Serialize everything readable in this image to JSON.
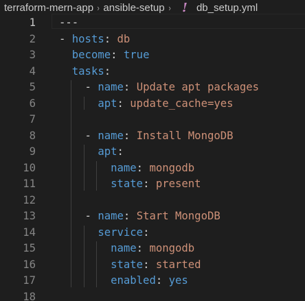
{
  "breadcrumb": {
    "folder1": "terraform-mern-app",
    "folder2": "ansible-setup",
    "file_name": "db_setup.yml",
    "separator": "›",
    "file_icon": "yaml-file-icon"
  },
  "editor": {
    "language": "yaml",
    "active_line": 1,
    "lines": [
      {
        "n": "1",
        "tokens": [
          [
            "t-dash",
            "---"
          ]
        ]
      },
      {
        "n": "2",
        "tokens": [
          [
            "t-dash",
            "- "
          ],
          [
            "t-key",
            "hosts"
          ],
          [
            "t-colon",
            ": "
          ],
          [
            "t-str",
            "db"
          ]
        ]
      },
      {
        "n": "3",
        "tokens": [
          [
            "t-dash",
            "  "
          ],
          [
            "t-key",
            "become"
          ],
          [
            "t-colon",
            ": "
          ],
          [
            "t-bool",
            "true"
          ]
        ]
      },
      {
        "n": "4",
        "tokens": [
          [
            "t-dash",
            "  "
          ],
          [
            "t-key",
            "tasks"
          ],
          [
            "t-colon",
            ":"
          ]
        ]
      },
      {
        "n": "5",
        "tokens": [
          [
            "t-dash",
            "    - "
          ],
          [
            "t-key",
            "name"
          ],
          [
            "t-colon",
            ": "
          ],
          [
            "t-str",
            "Update apt packages"
          ]
        ]
      },
      {
        "n": "6",
        "tokens": [
          [
            "t-dash",
            "      "
          ],
          [
            "t-key",
            "apt"
          ],
          [
            "t-colon",
            ": "
          ],
          [
            "t-str",
            "update_cache=yes"
          ]
        ]
      },
      {
        "n": "7",
        "tokens": []
      },
      {
        "n": "8",
        "tokens": [
          [
            "t-dash",
            "    - "
          ],
          [
            "t-key",
            "name"
          ],
          [
            "t-colon",
            ": "
          ],
          [
            "t-str",
            "Install MongoDB"
          ]
        ]
      },
      {
        "n": "9",
        "tokens": [
          [
            "t-dash",
            "      "
          ],
          [
            "t-key",
            "apt"
          ],
          [
            "t-colon",
            ":"
          ]
        ]
      },
      {
        "n": "10",
        "tokens": [
          [
            "t-dash",
            "        "
          ],
          [
            "t-key",
            "name"
          ],
          [
            "t-colon",
            ": "
          ],
          [
            "t-str",
            "mongodb"
          ]
        ]
      },
      {
        "n": "11",
        "tokens": [
          [
            "t-dash",
            "        "
          ],
          [
            "t-key",
            "state"
          ],
          [
            "t-colon",
            ": "
          ],
          [
            "t-str",
            "present"
          ]
        ]
      },
      {
        "n": "12",
        "tokens": []
      },
      {
        "n": "13",
        "tokens": [
          [
            "t-dash",
            "    - "
          ],
          [
            "t-key",
            "name"
          ],
          [
            "t-colon",
            ": "
          ],
          [
            "t-str",
            "Start MongoDB"
          ]
        ]
      },
      {
        "n": "14",
        "tokens": [
          [
            "t-dash",
            "      "
          ],
          [
            "t-key",
            "service"
          ],
          [
            "t-colon",
            ":"
          ]
        ]
      },
      {
        "n": "15",
        "tokens": [
          [
            "t-dash",
            "        "
          ],
          [
            "t-key",
            "name"
          ],
          [
            "t-colon",
            ": "
          ],
          [
            "t-str",
            "mongodb"
          ]
        ]
      },
      {
        "n": "16",
        "tokens": [
          [
            "t-dash",
            "        "
          ],
          [
            "t-key",
            "state"
          ],
          [
            "t-colon",
            ": "
          ],
          [
            "t-str",
            "started"
          ]
        ]
      },
      {
        "n": "17",
        "tokens": [
          [
            "t-dash",
            "        "
          ],
          [
            "t-key",
            "enabled"
          ],
          [
            "t-colon",
            ": "
          ],
          [
            "t-bool",
            "yes"
          ]
        ]
      },
      {
        "n": "18",
        "tokens": []
      }
    ]
  },
  "colors": {
    "background": "#1e1e1e",
    "key": "#569cd6",
    "string": "#ce9178",
    "punctuation": "#d4d4d4",
    "line_number": "#858585",
    "active_line_number": "#c6c6c6"
  }
}
